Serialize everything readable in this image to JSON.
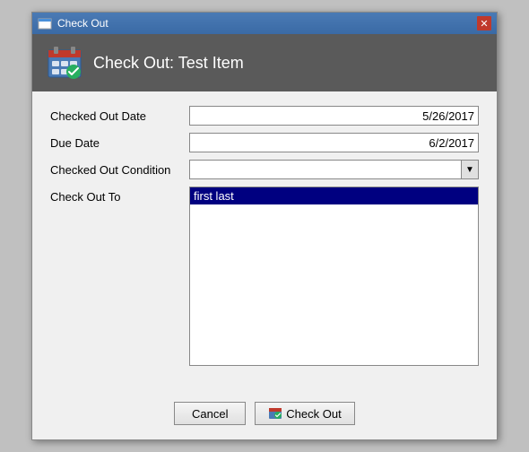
{
  "window": {
    "title": "Check Out"
  },
  "dialog": {
    "header_title": "Check Out: Test Item"
  },
  "form": {
    "checked_out_date_label": "Checked Out Date",
    "checked_out_date_value": "5/26/2017",
    "due_date_label": "Due Date",
    "due_date_value": "6/2/2017",
    "checked_out_condition_label": "Checked Out Condition",
    "checked_out_condition_value": "",
    "check_out_to_label": "Check Out To",
    "check_out_to_selected": "first last"
  },
  "buttons": {
    "cancel_label": "Cancel",
    "checkout_label": "Check Out"
  }
}
